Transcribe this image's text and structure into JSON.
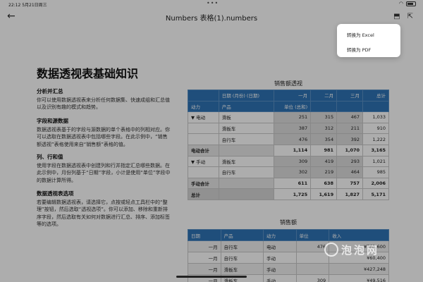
{
  "status": {
    "time": "22:12  5月21日周三",
    "dots": "•••"
  },
  "nav": {
    "back": "←",
    "title": "Numbers 表格(1).numbers",
    "icon_a": "⬒",
    "icon_b": "⇱"
  },
  "popup": {
    "excel": "转换为 Excel",
    "pdf": "转换为 PDF"
  },
  "doc": {
    "heading": "数据透视表基础知识",
    "sections": [
      {
        "title": "分析并汇总",
        "body": "你可以使用数据透视表来分析任何数据集、快速成组和汇总值以及识别有趣的模式和趋势。"
      },
      {
        "title": "字段和源数据",
        "body": "数据透视表基于的字段与源数据的单个表格中的列相对应。你可以选取在数据透视表中包括哪些字段。在此示例中，“销售额透视”表格使用来自“销售额”表格的值。"
      },
      {
        "title": "列、行和值",
        "body": "使用字段在数据透视表中创建列和行并指定汇总哪些数据。在此示例中，月份列基于“日期”字段，小计是使用“单位”字段中的数据计算所得。"
      },
      {
        "title": "数据透视表选项",
        "body": "若要编辑数据透视表，请选择它，点按或轻点工具栏中的“整理”按钮，然后选取“透视选项”。你可以添加、移除和重新排序字段，然后选取有关如何对数据进行汇总、排序、添加标签等的选项。"
      }
    ]
  },
  "pivot": {
    "title": "销售额透视",
    "h1": [
      "",
      "日期 (月份) (日期)",
      "一月",
      "二月",
      "三月",
      "总计"
    ],
    "h2": [
      "动力",
      "产品",
      "单位 (总和)",
      "",
      "",
      ""
    ],
    "rows": [
      {
        "c": [
          "▼ 电动",
          "滑板",
          "251",
          "315",
          "467",
          "1,033"
        ],
        "type": "data"
      },
      {
        "c": [
          "",
          "滑板车",
          "387",
          "312",
          "211",
          "910"
        ],
        "type": "data"
      },
      {
        "c": [
          "",
          "自行车",
          "476",
          "354",
          "392",
          "1,222"
        ],
        "type": "data"
      },
      {
        "c": [
          "电动合计",
          "",
          "1,114",
          "981",
          "1,070",
          "3,165"
        ],
        "type": "sub"
      },
      {
        "c": [
          "▼ 手动",
          "滑板车",
          "309",
          "419",
          "293",
          "1,021"
        ],
        "type": "data"
      },
      {
        "c": [
          "",
          "自行车",
          "302",
          "219",
          "464",
          "985"
        ],
        "type": "data"
      },
      {
        "c": [
          "手动合计",
          "",
          "611",
          "638",
          "757",
          "2,006"
        ],
        "type": "sub"
      },
      {
        "c": [
          "总计",
          "",
          "1,725",
          "1,619",
          "1,827",
          "5,171"
        ],
        "type": "total"
      }
    ]
  },
  "sales": {
    "title": "销售额",
    "header": [
      "日期",
      "产品",
      "动力",
      "单位",
      "收入"
    ],
    "rows": [
      [
        "一月",
        "自行车",
        "电动",
        "476",
        "¥761,600"
      ],
      [
        "一月",
        "自行车",
        "手动",
        "",
        "¥60,400"
      ],
      [
        "一月",
        "滑板车",
        "手动",
        "",
        "¥427,248"
      ],
      [
        "一月",
        "滑板车",
        "手动",
        "309",
        "¥49,516"
      ]
    ]
  },
  "watermark": "泡泡网"
}
